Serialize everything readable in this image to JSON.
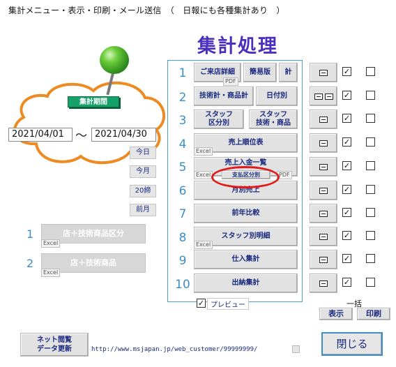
{
  "window": {
    "title": "集計メニュー・表示・印刷・メール送信　（　日報にも各種集計あり　）"
  },
  "main_title": "集計処理",
  "period": {
    "label": "集計期間",
    "start_date": "2021/04/01",
    "separator": "〜",
    "end_date": "2021/04/30",
    "shortcuts": [
      "今日",
      "今月",
      "20締",
      "前月"
    ]
  },
  "left_menu": [
    {
      "num": "1",
      "label": "店＋技術商品区分",
      "tag": "Excel"
    },
    {
      "num": "2",
      "label": "店＋技術商品",
      "tag": "Excel"
    }
  ],
  "rows": [
    {
      "num": "1",
      "buttons": [
        "ご来店詳細",
        "簡易版",
        "計"
      ],
      "tag": "PDF"
    },
    {
      "num": "2",
      "buttons": [
        "技術計・商品計",
        "日付別"
      ]
    },
    {
      "num": "3",
      "buttons": [
        "スタッフ\n区分別",
        "スタッフ\n技術・商品"
      ]
    },
    {
      "num": "4",
      "buttons": [
        "売上順位表"
      ],
      "tag": "Excel"
    },
    {
      "num": "5",
      "buttons": [
        "売上入金一覧"
      ],
      "tag": "Excel",
      "sub": "支払区分別",
      "tag2": "PDF"
    },
    {
      "num": "6",
      "buttons": [
        "月別売上"
      ]
    },
    {
      "num": "7",
      "buttons": [
        "前年比較"
      ]
    },
    {
      "num": "8",
      "buttons": [
        "スタッフ別明細"
      ],
      "tag": "Excel"
    },
    {
      "num": "9",
      "buttons": [
        "仕入集計"
      ]
    },
    {
      "num": "10",
      "buttons": [
        "出納集計"
      ]
    }
  ],
  "preview_label": "プレビュー",
  "bulk": {
    "label": "一括",
    "show": "表示",
    "print": "印刷"
  },
  "net_button": "ネット閲覧\nデータ更新",
  "url": "http://www.msjapan.jp/web_customer/99999999/",
  "close_button": "閉じる",
  "check_mark": "✓",
  "colors": {
    "accent": "#4a2fc0",
    "number_blue": "#3d8fc3",
    "pin_green": "#2c8a1c",
    "highlight_red": "#e01a1a"
  }
}
